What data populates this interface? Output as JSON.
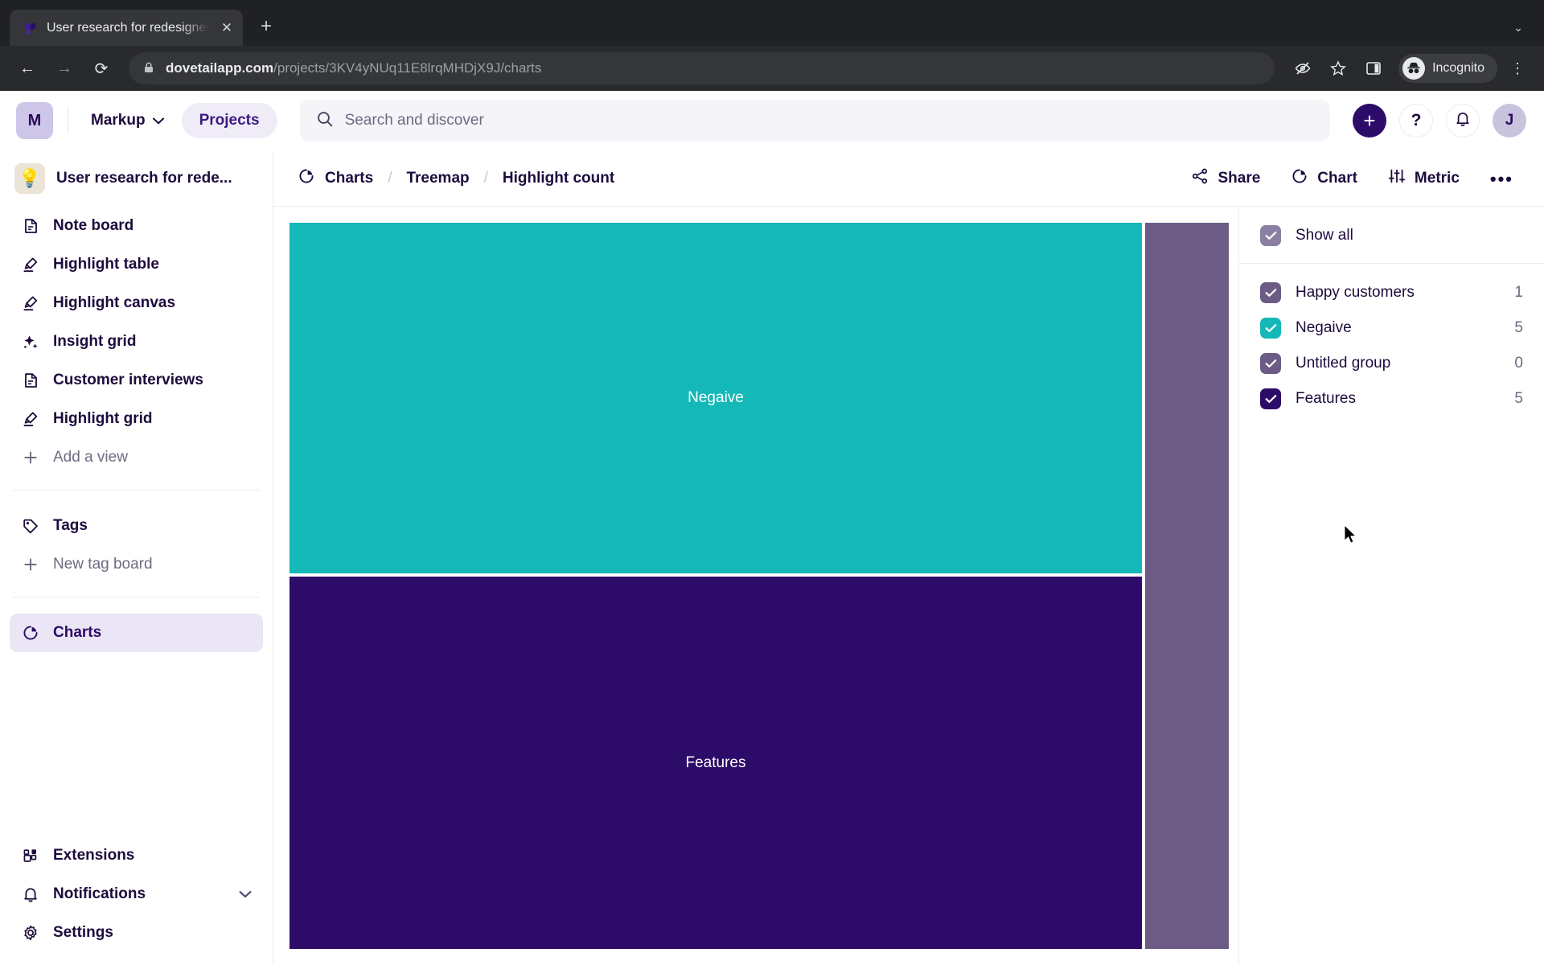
{
  "browser": {
    "tab": {
      "title": "User research for redesigned m",
      "favicon_name": "dovetail-favicon",
      "close_label": "✕"
    },
    "new_tab_label": "+",
    "tabstrip_caret": "⌄",
    "nav": {
      "back": "←",
      "forward": "→",
      "reload": "⟳"
    },
    "omnibox": {
      "lock": "🔒",
      "url_domain": "dovetailapp.com",
      "url_path": "/projects/3KV4yNUq11E8lrqMHDjX9J/charts"
    },
    "toolbar_icons": [
      "eye-off-icon",
      "bookmark-star-icon",
      "side-panel-icon"
    ],
    "incognito_label": "Incognito",
    "menu_label": "⋮"
  },
  "header": {
    "workspace_initial": "M",
    "workspace_name": "Markup",
    "workspace_caret": "⌄",
    "projects_pill": "Projects",
    "search_placeholder": "Search and discover",
    "add_label": "+",
    "help_label": "?",
    "notifications_icon": "bell-icon",
    "user_initial": "J"
  },
  "sidebar": {
    "project_emoji": "💡",
    "project_title": "User research for rede...",
    "views": [
      {
        "label": "Note board",
        "icon": "document-icon"
      },
      {
        "label": "Highlight table",
        "icon": "highlighter-icon"
      },
      {
        "label": "Highlight canvas",
        "icon": "highlighter-icon"
      },
      {
        "label": "Insight grid",
        "icon": "sparkles-icon"
      },
      {
        "label": "Customer interviews",
        "icon": "document-icon"
      },
      {
        "label": "Highlight grid",
        "icon": "highlighter-icon"
      },
      {
        "label": "Add a view",
        "icon": "plus-icon",
        "muted": true
      }
    ],
    "tags": [
      {
        "label": "Tags",
        "icon": "tag-icon"
      },
      {
        "label": "New tag board",
        "icon": "plus-icon",
        "muted": true
      }
    ],
    "charts": {
      "label": "Charts",
      "icon": "pie-chart-icon",
      "active": true
    },
    "bottom": [
      {
        "label": "Extensions",
        "icon": "extensions-icon"
      },
      {
        "label": "Notifications",
        "icon": "bell-icon",
        "caret": "⌄"
      },
      {
        "label": "Settings",
        "icon": "gear-icon"
      }
    ]
  },
  "content": {
    "breadcrumb": [
      {
        "label": "Charts",
        "icon": "pie-chart-icon"
      },
      {
        "label": "Treemap"
      },
      {
        "label": "Highlight count"
      }
    ],
    "breadcrumb_separator": "/",
    "actions": [
      {
        "label": "Share",
        "icon": "share-icon"
      },
      {
        "label": "Chart",
        "icon": "pie-chart-icon"
      },
      {
        "label": "Metric",
        "icon": "sliders-icon"
      }
    ],
    "more_label": "•••"
  },
  "legend": {
    "show_all_label": "Show all",
    "show_all_color": "#8b80a3",
    "items": [
      {
        "label": "Happy customers",
        "count": "1",
        "color": "#6b5b85"
      },
      {
        "label": "Negaive",
        "count": "5",
        "color": "#14b8b8"
      },
      {
        "label": "Untitled group",
        "count": "0",
        "color": "#6b5b85"
      },
      {
        "label": "Features",
        "count": "5",
        "color": "#2d0b68"
      }
    ]
  },
  "chart_data": {
    "type": "treemap",
    "title": "Highlight count",
    "chart_kind": "Treemap",
    "legend_position": "right",
    "categories": [
      "Negaive",
      "Features",
      "Happy customers",
      "Untitled group"
    ],
    "values": [
      5,
      5,
      1,
      0
    ],
    "colors": [
      "#14b8b8",
      "#2d0b68",
      "#6b5b85",
      "#6b5b85"
    ],
    "tiles": [
      {
        "label": "Negaive",
        "value": 5,
        "color": "#14b8b8",
        "show_label": true
      },
      {
        "label": "Features",
        "value": 5,
        "color": "#2d0b68",
        "show_label": true
      },
      {
        "label": "Happy customers",
        "value": 1,
        "color": "#6b5b85",
        "show_label": false
      }
    ],
    "xlabel": "",
    "ylabel": ""
  }
}
